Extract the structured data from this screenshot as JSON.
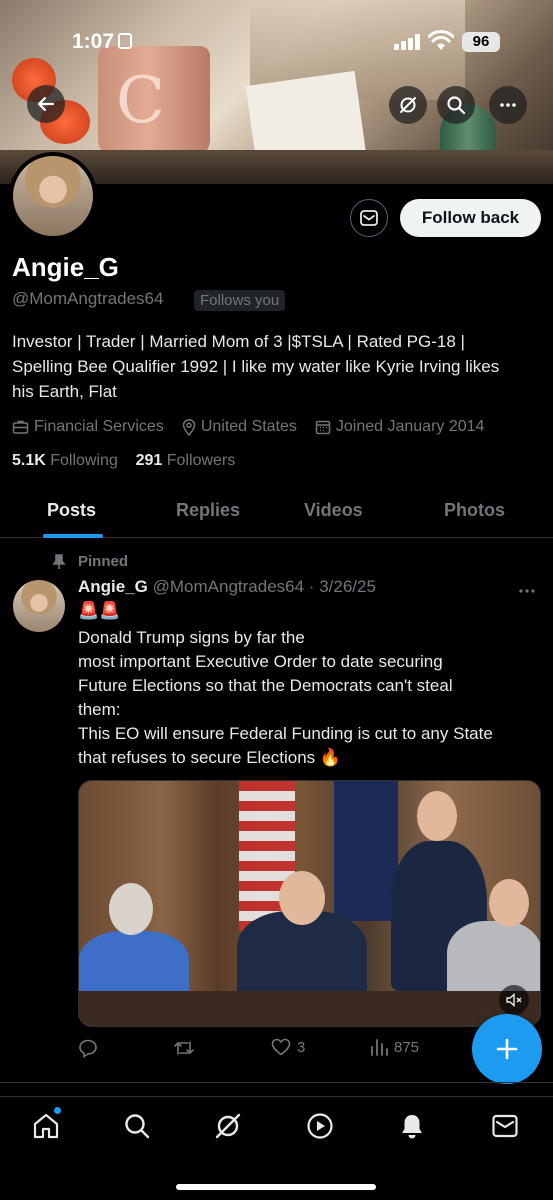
{
  "status_bar": {
    "time": "1:07",
    "battery": "96"
  },
  "profile": {
    "display_name": "Angie_G",
    "handle": "@MomAngtrades64",
    "follows_you": "Follows you",
    "follow_label": "Follow back",
    "bio_lines": [
      "Investor | Trader | Married Mom of 3 |$TSLA | Rated PG-18 |",
      "Spelling Bee Qualifier 1992 | I like my water like Kyrie Irving likes",
      "his Earth, Flat"
    ],
    "category": "Financial Services",
    "location": "United States",
    "joined": "Joined January 2014",
    "following_count": "5.1K",
    "following_label": "Following",
    "followers_count": "291",
    "followers_label": "Followers"
  },
  "tabs": [
    {
      "label": "Posts",
      "active": true
    },
    {
      "label": "Replies",
      "active": false
    },
    {
      "label": "Videos",
      "active": false
    },
    {
      "label": "Photos",
      "active": false
    }
  ],
  "post": {
    "pinned_label": "Pinned",
    "author_name": "Angie_G",
    "author_meta": "@MomAngtrades64 · 3/26/25",
    "emoji": "🚨🚨",
    "text_lines": [
      "Donald Trump signs by far the",
      "most important Executive Order to date securing",
      "Future Elections so that the Democrats can't steal",
      "them:",
      "This EO will ensure Federal Funding is cut to any State",
      "that refuses to secure Elections 🔥"
    ],
    "likes": "3",
    "views": "875"
  },
  "colors": {
    "accent": "#1d9bf0",
    "muted": "#71767b",
    "text": "#e7e9ea",
    "background": "#000000"
  },
  "icons": [
    "back-arrow-icon",
    "grok-icon",
    "search-icon",
    "more-icon",
    "mail-icon",
    "briefcase-icon",
    "location-pin-icon",
    "calendar-icon",
    "pin-icon",
    "reply-icon",
    "repost-icon",
    "like-icon",
    "views-icon",
    "mute-icon",
    "compose-plus-icon",
    "home-icon",
    "explore-icon",
    "grok-nav-icon",
    "video-icon",
    "notifications-icon",
    "messages-icon"
  ]
}
